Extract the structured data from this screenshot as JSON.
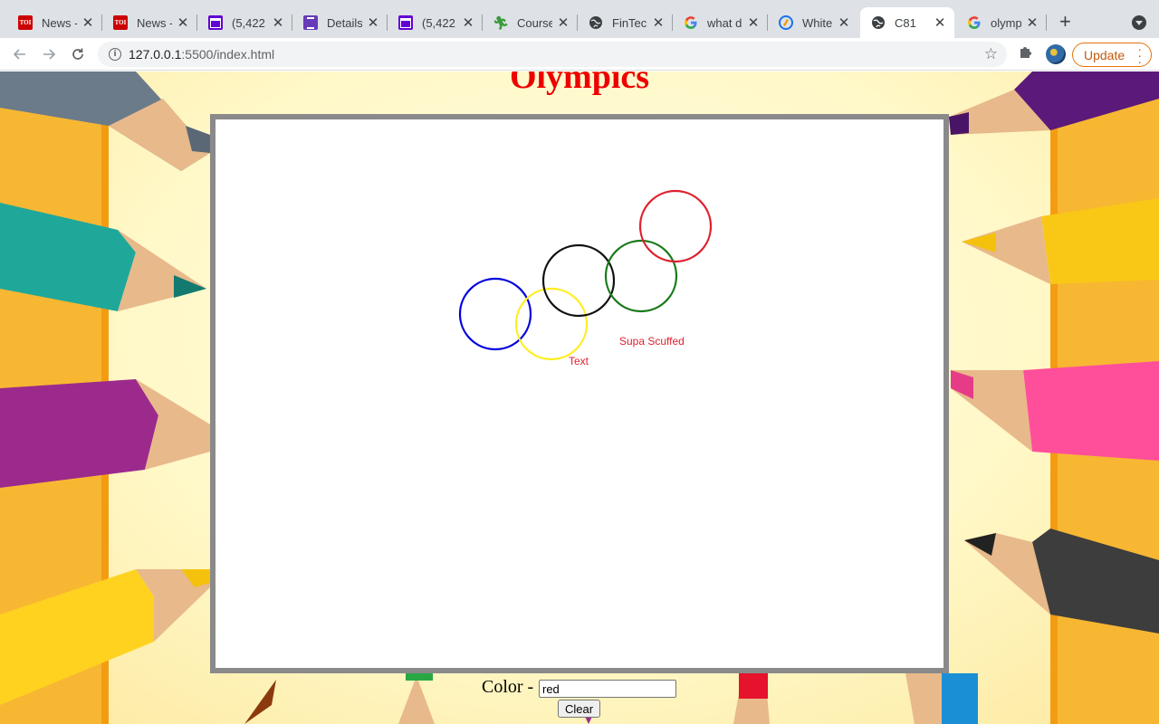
{
  "tabs": [
    {
      "title": "News -",
      "favicon": "toi-icon",
      "favicon_text": "TOI"
    },
    {
      "title": "News -",
      "favicon": "toi-icon",
      "favicon_text": "TOI"
    },
    {
      "title": "(5,422",
      "favicon": "mail-icon"
    },
    {
      "title": "Details",
      "favicon": "forms-icon"
    },
    {
      "title": "(5,422",
      "favicon": "mail-icon"
    },
    {
      "title": "Course",
      "favicon": "runner-icon"
    },
    {
      "title": "FinTech",
      "favicon": "globe-icon"
    },
    {
      "title": "what d",
      "favicon": "google-icon"
    },
    {
      "title": "WhiteH",
      "favicon": "whitehat-icon"
    },
    {
      "title": "C81",
      "favicon": "globe-icon",
      "active": true
    },
    {
      "title": "olympi",
      "favicon": "google-icon"
    }
  ],
  "toolbar": {
    "url_host": "127.0.0.1",
    "url_rest": ":5500/index.html",
    "update_label": "Update"
  },
  "page": {
    "title": "Olympics",
    "title_color": "#ee0000",
    "canvas": {
      "rings": [
        {
          "color": "#0000dd",
          "name": "blue-ring"
        },
        {
          "color": "#ffee22",
          "name": "yellow-ring"
        },
        {
          "color": "#111111",
          "name": "black-ring"
        },
        {
          "color": "#1a7a1a",
          "name": "green-ring"
        },
        {
          "color": "#e0202e",
          "name": "red-ring"
        }
      ],
      "texts": [
        {
          "text": "Text",
          "color": "#e0202e"
        },
        {
          "text": "Supa Scuffed",
          "color": "#e0202e"
        }
      ]
    },
    "controls": {
      "color_label": "Color -",
      "color_value": "red",
      "clear_label": "Clear"
    }
  }
}
